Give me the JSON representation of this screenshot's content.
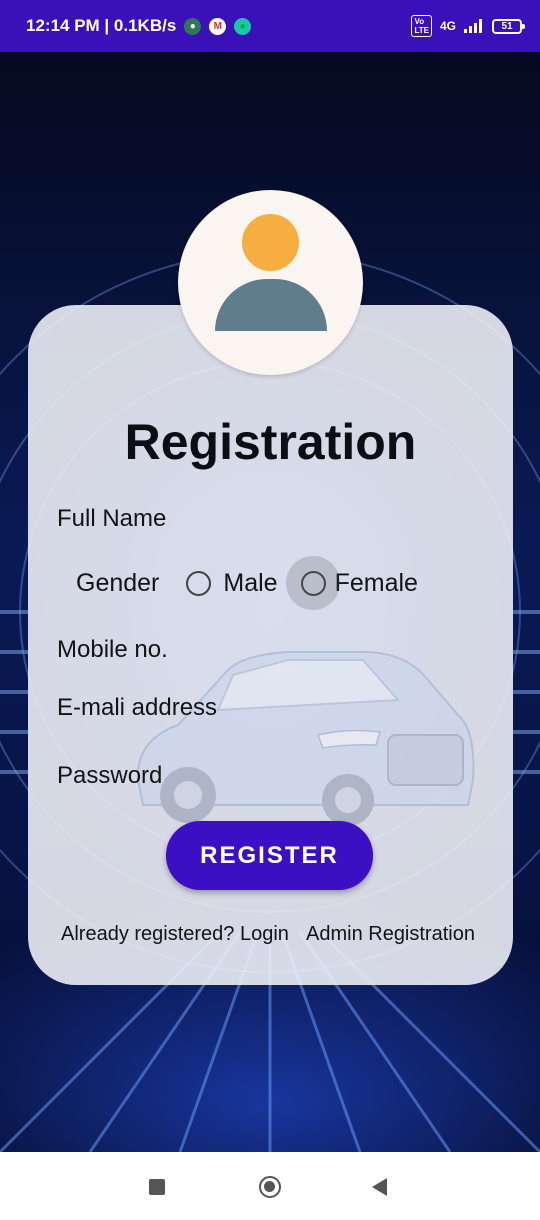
{
  "status_bar": {
    "time_speed": "12:14 PM | 0.1KB/s",
    "volte": "VoLTE",
    "network": "4G",
    "battery": "51"
  },
  "form": {
    "title": "Registration",
    "full_name_label": "Full Name",
    "gender_label": "Gender",
    "gender_options": [
      "Male",
      "Female"
    ],
    "mobile_label": "Mobile no.",
    "email_label": "E-mali address",
    "password_label": "Password",
    "register_button": "REGISTER",
    "login_link": "Already registered? Login",
    "admin_link": "Admin Registration"
  },
  "colors": {
    "status_bar": "#3a10b8",
    "button": "#3b10c4",
    "avatar_head": "#f7ae41",
    "avatar_body": "#607d8b"
  }
}
